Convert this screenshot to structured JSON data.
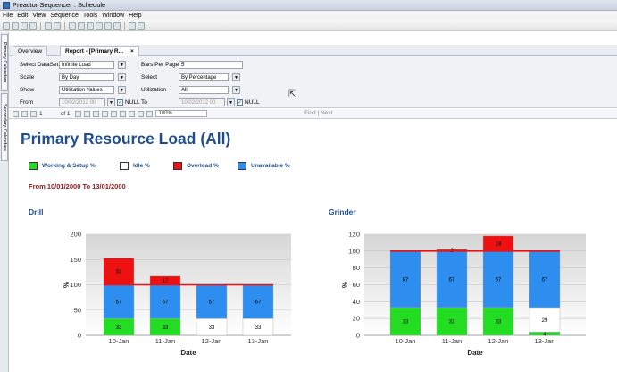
{
  "window": {
    "title": "Preactor Sequencer : Schedule"
  },
  "menu": [
    "File",
    "Edit",
    "View",
    "Sequence",
    "Tools",
    "Window",
    "Help"
  ],
  "side_tabs": [
    "Primary Calendars",
    "Secondary Calendars"
  ],
  "doc_tabs": {
    "overview": "Overview",
    "report": "Report - [Primary R...",
    "close": "×"
  },
  "params": {
    "dataset_label": "Select DataSet",
    "dataset_value": "Infinite Load",
    "scale_label": "Scale",
    "scale_value": "By Day",
    "show_label": "Show",
    "show_value": "Utilization Values",
    "from_label": "From",
    "from_value": "10/02/2012 00",
    "null_label": "NULL",
    "bars_label": "Bars Per Page",
    "bars_value": "5",
    "select_label": "Select",
    "select_value": "By Percentage",
    "util_label": "Utilization",
    "util_value": "All",
    "to_label": "To",
    "to_value": "10/02/2012 00",
    "check_mark": "✓"
  },
  "nav": {
    "page": "1",
    "of": "of 1",
    "zoom": "100%",
    "find": "Find",
    "next": "Next",
    "sep": "|"
  },
  "report": {
    "title": "Primary Resource Load (All)",
    "legend": [
      {
        "label": "Working & Setup %",
        "color": "#22dd22"
      },
      {
        "label": "Idle %",
        "color": "#ffffff"
      },
      {
        "label": "Overload %",
        "color": "#ee1111"
      },
      {
        "label": "Unavailable %",
        "color": "#2e8ef0"
      }
    ],
    "date_range": "From 10/01/2000 To 13/01/2000"
  },
  "chart_data": [
    {
      "type": "bar",
      "stacked": true,
      "title": "Drill",
      "xlabel": "Date",
      "ylabel": "%",
      "categories": [
        "10-Jan",
        "11-Jan",
        "12-Jan",
        "13-Jan"
      ],
      "ylim": [
        0,
        200
      ],
      "yticks": [
        0,
        50,
        100,
        150,
        200
      ],
      "reference_line": 100,
      "series": [
        {
          "name": "Working & Setup %",
          "color": "#22dd22",
          "values": [
            33,
            33,
            0,
            0
          ],
          "labels": [
            "33",
            "33",
            "",
            ""
          ]
        },
        {
          "name": "Idle %",
          "color": "#ffffff",
          "values": [
            0,
            0,
            33,
            33
          ],
          "labels": [
            "",
            "",
            "33",
            "33"
          ]
        },
        {
          "name": "Unavailable %",
          "color": "#2e8ef0",
          "values": [
            67,
            67,
            67,
            67
          ],
          "labels": [
            "67",
            "67",
            "67",
            "67"
          ]
        },
        {
          "name": "Overload %",
          "color": "#ee1111",
          "values": [
            53,
            17,
            0,
            0
          ],
          "labels": [
            "53",
            "17",
            "",
            ""
          ]
        }
      ]
    },
    {
      "type": "bar",
      "stacked": true,
      "title": "Grinder",
      "xlabel": "Date",
      "ylabel": "%",
      "categories": [
        "10-Jan",
        "11-Jan",
        "12-Jan",
        "13-Jan"
      ],
      "ylim": [
        0,
        120
      ],
      "yticks": [
        0,
        20,
        40,
        60,
        80,
        100,
        120
      ],
      "reference_line": 100,
      "series": [
        {
          "name": "Working & Setup %",
          "color": "#22dd22",
          "values": [
            33,
            33,
            33,
            4
          ],
          "labels": [
            "33",
            "33",
            "33",
            "4"
          ]
        },
        {
          "name": "Idle %",
          "color": "#ffffff",
          "values": [
            0,
            0,
            0,
            29
          ],
          "labels": [
            "",
            "",
            "",
            "29"
          ]
        },
        {
          "name": "Unavailable %",
          "color": "#2e8ef0",
          "values": [
            67,
            67,
            67,
            67
          ],
          "labels": [
            "67",
            "67",
            "67",
            "67"
          ]
        },
        {
          "name": "Overload %",
          "color": "#ee1111",
          "values": [
            0,
            2,
            18,
            0
          ],
          "labels": [
            "",
            "2",
            "18",
            ""
          ]
        }
      ]
    }
  ]
}
